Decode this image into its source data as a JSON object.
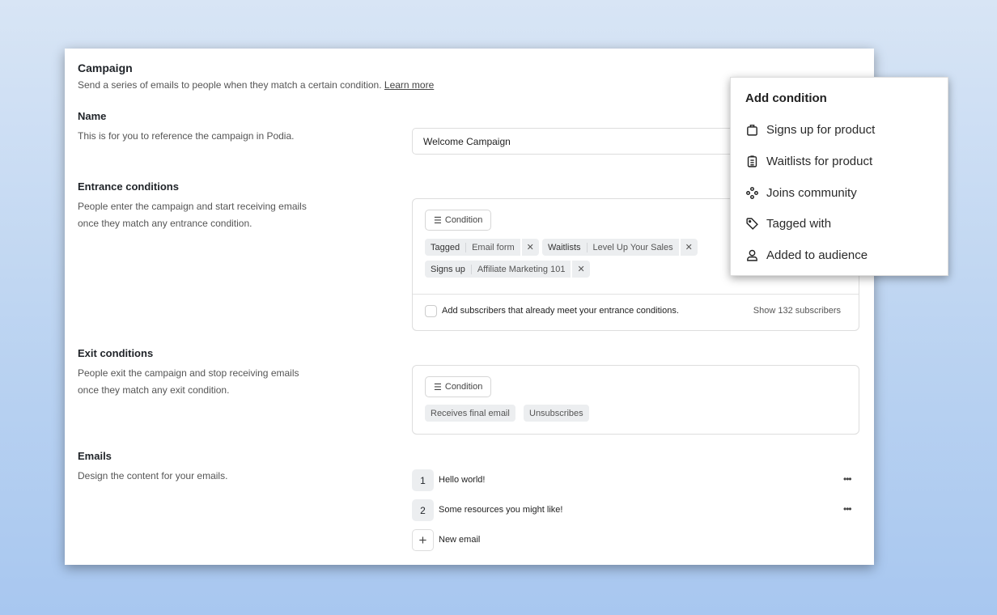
{
  "campaign": {
    "title": "Campaign",
    "description": "Send a series of emails to people when they match a certain condition.",
    "learn_more": "Learn more"
  },
  "name": {
    "title": "Name",
    "description": "This is for you to reference the campaign in Podia.",
    "value": "Welcome Campaign"
  },
  "entrance": {
    "title": "Entrance conditions",
    "description_1": "People enter the campaign and start receiving emails",
    "description_2": "once they match any entrance condition.",
    "condition_button": "Condition",
    "chips": [
      {
        "key": "Tagged",
        "value": "Email form"
      },
      {
        "key": "Waitlists",
        "value": "Level Up Your Sales"
      },
      {
        "key": "Signs up",
        "value": "Affiliate Marketing 101"
      }
    ],
    "checkbox_label": "Add subscribers that already meet your entrance conditions.",
    "checkbox_checked": false,
    "show_subscribers": "Show 132 subscribers"
  },
  "exit": {
    "title": "Exit conditions",
    "description_1": "People exit the campaign and stop receiving emails",
    "description_2": "once they match any exit condition.",
    "condition_button": "Condition",
    "chips": [
      "Receives final email",
      "Unsubscribes"
    ]
  },
  "emails": {
    "title": "Emails",
    "description": "Design the content for your emails.",
    "items": [
      {
        "number": "1",
        "subject": "Hello world!"
      },
      {
        "number": "2",
        "subject": "Some resources you might like!"
      }
    ],
    "new_email": "New email"
  },
  "popup": {
    "title": "Add condition",
    "items": [
      {
        "label": "Signs up for product",
        "icon": "shopping-bag-icon"
      },
      {
        "label": "Waitlists for product",
        "icon": "clipboard-list-icon"
      },
      {
        "label": "Joins community",
        "icon": "community-icon"
      },
      {
        "label": "Tagged with",
        "icon": "tag-icon"
      },
      {
        "label": "Added to audience",
        "icon": "user-icon"
      }
    ]
  }
}
